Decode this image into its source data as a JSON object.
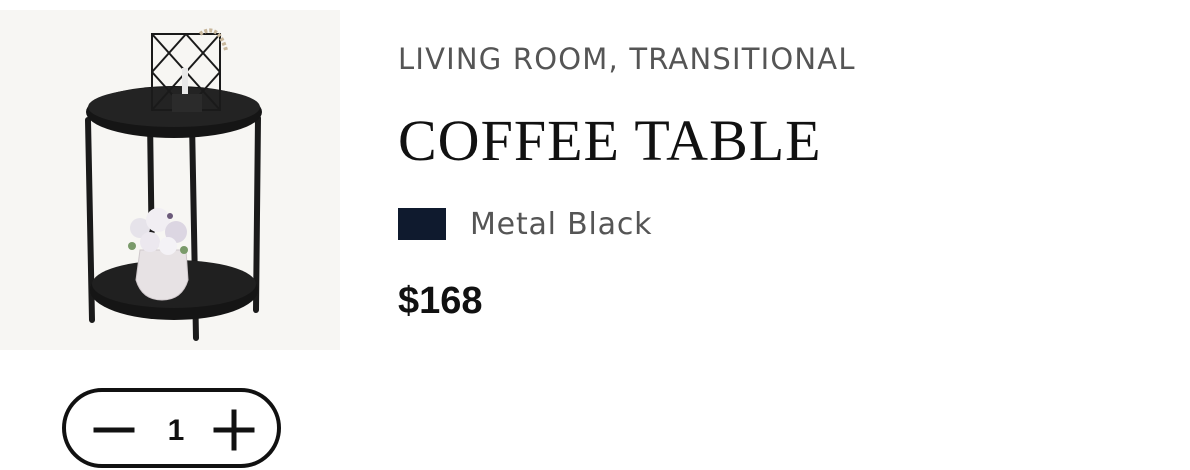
{
  "product": {
    "category": "LIVING ROOM, TRANSITIONAL",
    "title": "COFFEE TABLE",
    "color_name": "Metal Black",
    "swatch_color": "#0f1a2e",
    "price": "$168",
    "image_icon": "side-table-photo"
  },
  "quantity": {
    "value": "1",
    "minus_icon": "minus-icon",
    "plus_icon": "plus-icon"
  }
}
